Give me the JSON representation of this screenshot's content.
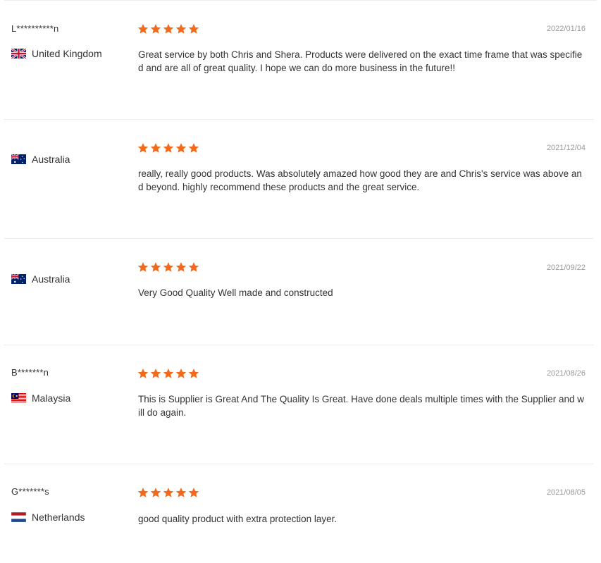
{
  "reviews": [
    {
      "buyer": "L**********n",
      "country": "United Kingdom",
      "flag": "gb-flag-icon",
      "rating": 5,
      "date": "2022/01/16",
      "text": "Great service by both Chris and Shera. Products were delivered on the exact time frame that was specified and are all of great quality. I hope we can do more business in the future!!"
    },
    {
      "buyer": "",
      "country": "Australia",
      "flag": "au-flag-icon",
      "rating": 5,
      "date": "2021/12/04",
      "text": "really, really good products. Was absolutely amazed how good they are and Chris's service was above and beyond. highly recommend these products and the great service."
    },
    {
      "buyer": "",
      "country": "Australia",
      "flag": "au-flag-icon",
      "rating": 5,
      "date": "2021/09/22",
      "text": "Very Good Quality Well made and constructed"
    },
    {
      "buyer": "B*******n",
      "country": "Malaysia",
      "flag": "my-flag-icon",
      "rating": 5,
      "date": "2021/08/26",
      "text": "This is Supplier is Great And The Quality Is Great. Have done deals multiple times with the Supplier and will do again."
    },
    {
      "buyer": "G*******s",
      "country": "Netherlands",
      "flag": "nl-flag-icon",
      "rating": 5,
      "date": "2021/08/05",
      "text": "good quality product with extra protection layer."
    }
  ],
  "colors": {
    "star": "#f26a1b",
    "date": "#999999",
    "divider": "#ececec"
  }
}
